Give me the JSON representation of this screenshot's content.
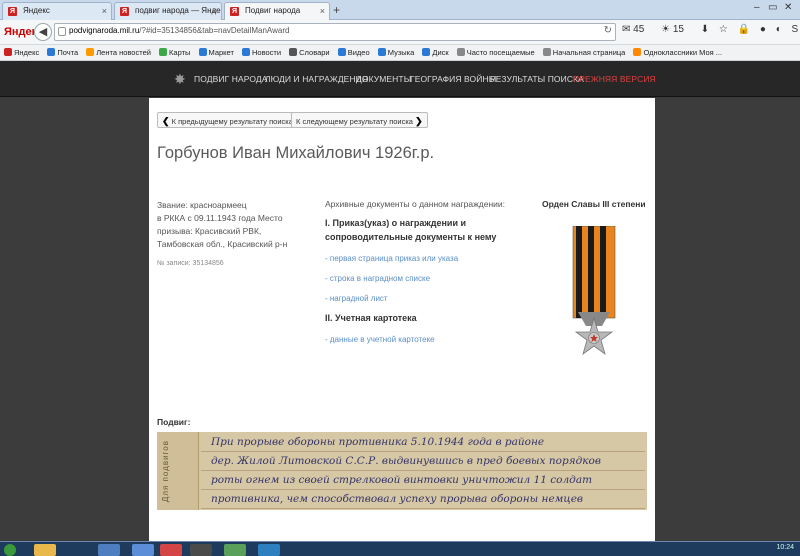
{
  "browser": {
    "tabs": [
      {
        "label": "Яндекс",
        "favicon": "Я",
        "active": false
      },
      {
        "label": "подвиг народа — Яндекс: ...",
        "favicon": "Я",
        "active": false
      },
      {
        "label": "Подвиг народа",
        "favicon": "Я",
        "active": true
      }
    ],
    "new_tab": "+",
    "logo": "Яндекс",
    "url_host": "podvignaroda.mil.ru",
    "url_path": "/?#id=35134856&tab=navDetailManAward",
    "toolbar_counters": {
      "mail": "45",
      "weather": "15"
    },
    "bookmarks": [
      {
        "label": "Яндекс",
        "color": "#cc2222"
      },
      {
        "label": "Почта",
        "color": "#2a7ad5"
      },
      {
        "label": "Лента новостей",
        "color": "#ff9900"
      },
      {
        "label": "Карты",
        "color": "#3aa845"
      },
      {
        "label": "Маркет",
        "color": "#2a7ad5"
      },
      {
        "label": "Новости",
        "color": "#2a7ad5"
      },
      {
        "label": "Словари",
        "color": "#555555"
      },
      {
        "label": "Видео",
        "color": "#2a7ad5"
      },
      {
        "label": "Музыка",
        "color": "#2a7ad5"
      },
      {
        "label": "Диск",
        "color": "#2a7ad5"
      },
      {
        "label": "Часто посещаемые",
        "color": "#888888"
      },
      {
        "label": "Начальная страница",
        "color": "#888888"
      },
      {
        "label": "Одноклассники Моя ...",
        "color": "#ff8800"
      }
    ]
  },
  "nav": {
    "items": [
      "ПОДВИГ НАРОДА",
      "ЛЮДИ И НАГРАЖДЕНИЯ",
      "ДОКУМЕНТЫ",
      "ГЕОГРАФИЯ ВОЙНЫ",
      "РЕЗУЛЬТАТЫ ПОИСКА",
      "ПРЕЖНЯЯ ВЕРСИЯ"
    ]
  },
  "pager": {
    "prev": "К предыдущему результату поиска",
    "next": "К следующему результату поиска"
  },
  "person": {
    "name": "Горбунов Иван Михайлович 1926г.р.",
    "rank": "Звание: красноармеец",
    "service": "в РККА с 09.11.1943 года Место призыва: Красивский РВК, Тамбовская обл., Красивский р-н",
    "record": "№ записи: 35134856"
  },
  "archive": {
    "title": "Архивные документы о данном награждении:",
    "section1": "I. Приказ(указ) о награждении и сопроводительные документы к нему",
    "links1": [
      "- первая страница приказ или указа",
      "- строка в наградном списке",
      "- наградной лист"
    ],
    "section2": "II. Учетная картотека",
    "links2": [
      "- данные в учетной картотеке"
    ]
  },
  "award": {
    "title": "Орден Славы III степени"
  },
  "feat": {
    "label": "Подвиг:",
    "side_text": "Для подвигов",
    "lines": [
      "При прорыве обороны противника 5.10.1944 года в районе",
      "дер. Жилой Литовской С.С.Р. выдвинувшись в пред боевых порядков",
      "роты огнем из своей стрелковой винтовки уничтожил 11 солдат",
      "противника, чем способствовал успеху прорыва обороны немцев"
    ]
  },
  "taskbar": {
    "clock": "10:24"
  }
}
